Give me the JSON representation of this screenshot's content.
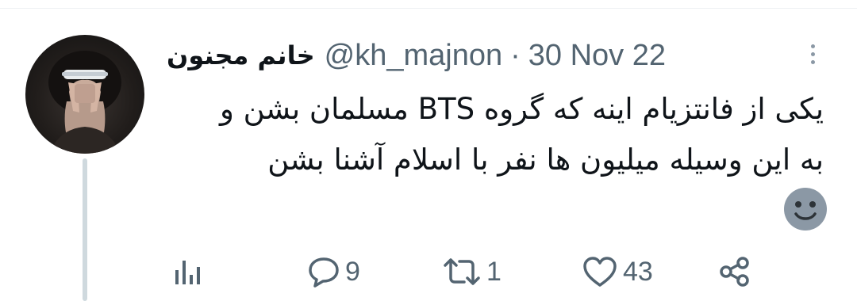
{
  "tweet": {
    "display_name": "خانم مجنون",
    "handle": "@kh_majnon",
    "separator": "·",
    "date": "30 Nov 22",
    "text_line1": "یکی از فانتزیام اینه که گروه BTS مسلمان بشن و",
    "text_line2": "به این وسیله میلیون ها نفر با اسلام آشنا بشن",
    "emoji": "slightly-smiling-face"
  },
  "actions": {
    "analytics_icon": "bar-chart-icon",
    "reply_icon": "speech-bubble-icon",
    "reply_count": "9",
    "retweet_icon": "retweet-arrows-icon",
    "retweet_count": "1",
    "like_icon": "heart-icon",
    "like_count": "43",
    "share_icon": "share-icon"
  },
  "colors": {
    "text": "#0f1419",
    "muted": "#536471",
    "thread_line": "#cfd9de",
    "emoji": "#8b98a5"
  }
}
